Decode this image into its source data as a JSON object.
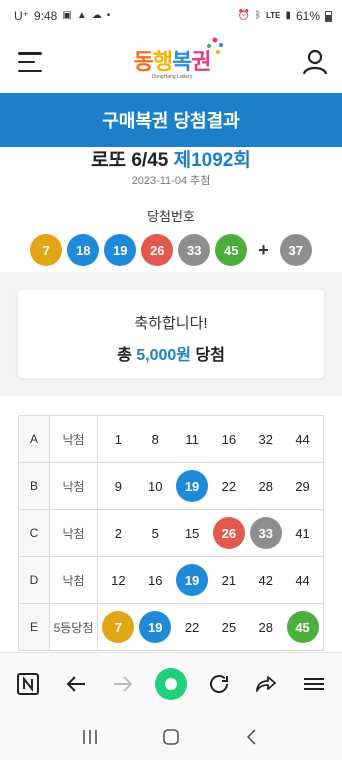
{
  "status_bar": {
    "carrier": "U⁺",
    "time": "9:48",
    "network": "LTE",
    "battery": "61%"
  },
  "header": {
    "logo_text": [
      "동",
      "행",
      "복",
      "권"
    ],
    "logo_sub": "DongHang Lottery"
  },
  "banner": {
    "title": "구매복권 당첨결과"
  },
  "draw": {
    "game": "로또 6/45",
    "round": "제1092회",
    "date": "2023-11-04 추첨",
    "label": "당첨번호"
  },
  "winning_numbers": [
    {
      "n": "7",
      "color": "#e2a516"
    },
    {
      "n": "18",
      "color": "#1f8ad8"
    },
    {
      "n": "19",
      "color": "#1f8ad8"
    },
    {
      "n": "26",
      "color": "#e25a4d"
    },
    {
      "n": "33",
      "color": "#8e8e8e"
    },
    {
      "n": "45",
      "color": "#4caf3c"
    }
  ],
  "bonus_plus": "+",
  "bonus_number": {
    "n": "37",
    "color": "#8e8e8e"
  },
  "result_card": {
    "congrats": "축하합니다!",
    "prefix": "총",
    "amount": "5,000원",
    "suffix": "당첨"
  },
  "tickets": [
    {
      "id": "A",
      "result": "낙첨",
      "numbers": [
        {
          "n": "1"
        },
        {
          "n": "8"
        },
        {
          "n": "11"
        },
        {
          "n": "16"
        },
        {
          "n": "32"
        },
        {
          "n": "44"
        }
      ]
    },
    {
      "id": "B",
      "result": "낙첨",
      "numbers": [
        {
          "n": "9"
        },
        {
          "n": "10"
        },
        {
          "n": "19",
          "hit": "#1f8ad8"
        },
        {
          "n": "22"
        },
        {
          "n": "28"
        },
        {
          "n": "29"
        }
      ]
    },
    {
      "id": "C",
      "result": "낙첨",
      "numbers": [
        {
          "n": "2"
        },
        {
          "n": "5"
        },
        {
          "n": "15"
        },
        {
          "n": "26",
          "hit": "#e25a4d"
        },
        {
          "n": "33",
          "hit": "#8e8e8e"
        },
        {
          "n": "41"
        }
      ]
    },
    {
      "id": "D",
      "result": "낙첨",
      "numbers": [
        {
          "n": "12"
        },
        {
          "n": "16"
        },
        {
          "n": "19",
          "hit": "#1f8ad8"
        },
        {
          "n": "21"
        },
        {
          "n": "42"
        },
        {
          "n": "44"
        }
      ]
    },
    {
      "id": "E",
      "result": "5등당첨",
      "numbers": [
        {
          "n": "7",
          "hit": "#e2a516"
        },
        {
          "n": "19",
          "hit": "#1f8ad8"
        },
        {
          "n": "22"
        },
        {
          "n": "25"
        },
        {
          "n": "28"
        },
        {
          "n": "45",
          "hit": "#4caf3c"
        }
      ]
    }
  ],
  "colors": {
    "accent": "#1b7fc9",
    "browser_home": "#1fd17a"
  }
}
